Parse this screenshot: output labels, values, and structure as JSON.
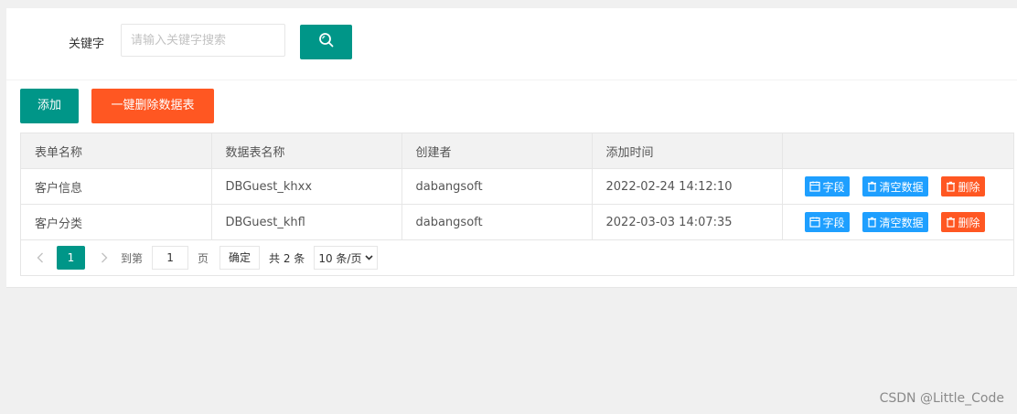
{
  "search": {
    "label": "关键字",
    "placeholder": "请输入关键字搜索",
    "value": ""
  },
  "toolbar": {
    "add_label": "添加",
    "delete_all_label": "一键删除数据表"
  },
  "table": {
    "columns": [
      "表单名称",
      "数据表名称",
      "创建者",
      "添加时间",
      ""
    ],
    "rows": [
      {
        "form_name": "客户信息",
        "table_name": "DBGuest_khxx",
        "creator": "dabangsoft",
        "added": "2022-02-24 14:12:10"
      },
      {
        "form_name": "客户分类",
        "table_name": "DBGuest_khfl",
        "creator": "dabangsoft",
        "added": "2022-03-03 14:07:35"
      }
    ],
    "row_actions": {
      "fields": "字段",
      "clear": "清空数据",
      "delete": "删除"
    }
  },
  "pager": {
    "current_page": "1",
    "goto_label": "到第",
    "goto_value": "1",
    "page_unit": "页",
    "confirm_label": "确定",
    "total_label": "共 2 条",
    "page_size": "10 条/页"
  },
  "watermark": "CSDN @Little_Code",
  "colors": {
    "primary": "#009688",
    "danger": "#ff5722",
    "info": "#1e9fff"
  }
}
